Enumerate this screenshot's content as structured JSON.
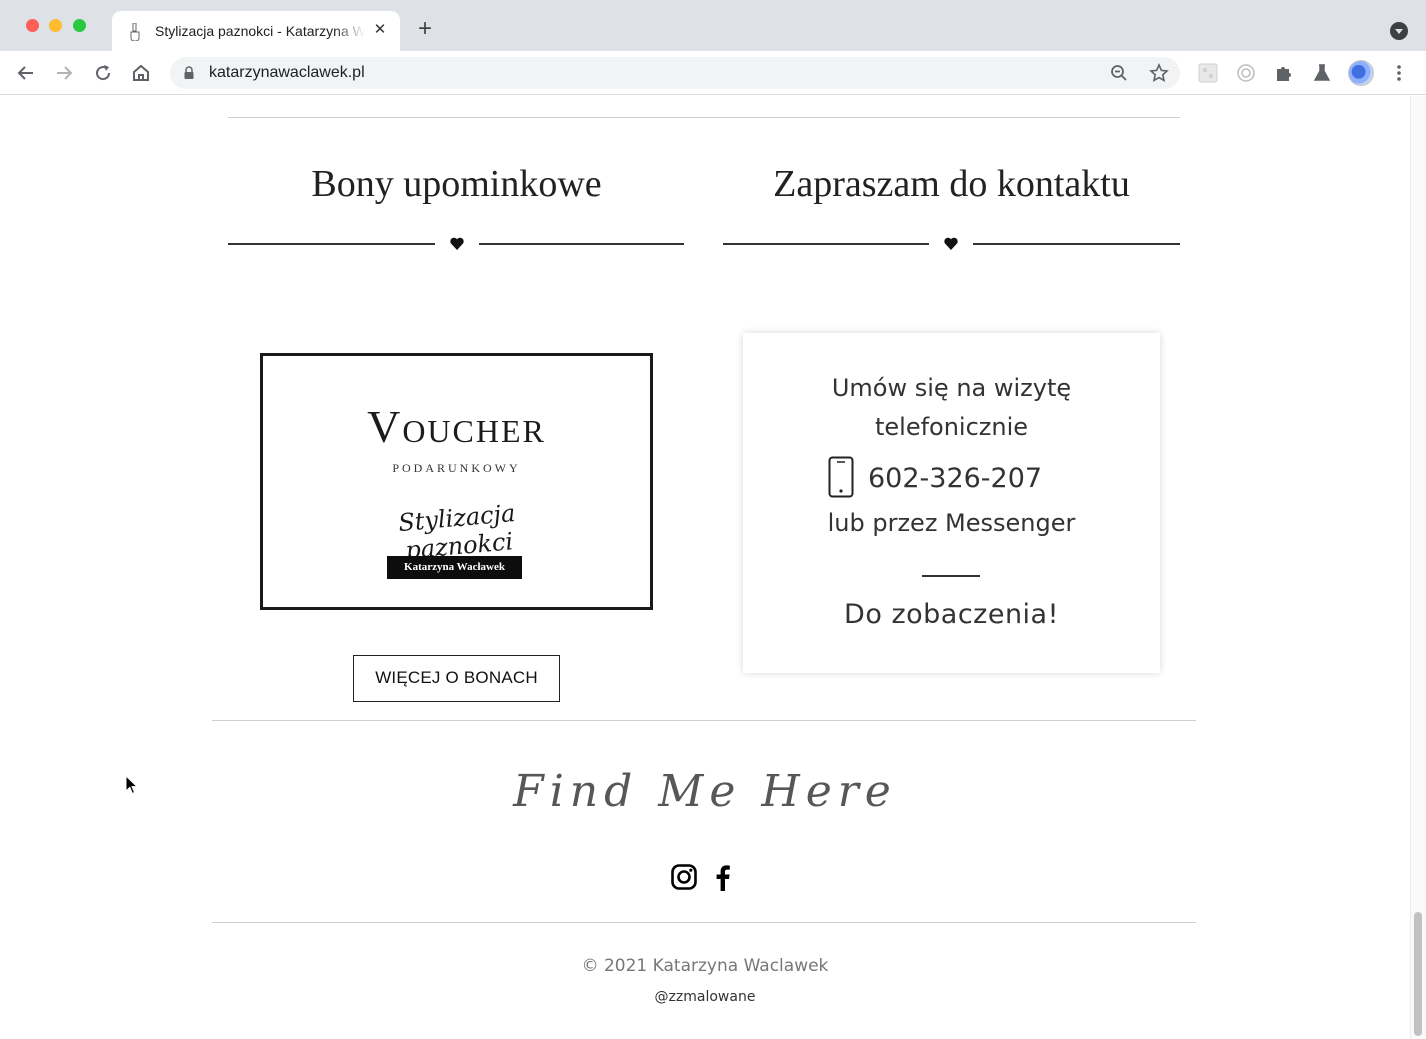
{
  "browser": {
    "tab_title": "Stylizacja paznokci - Katarzyna Waclawek",
    "new_tab_label": "+",
    "close_tab_label": "✕",
    "url": "katarzynawaclawek.pl"
  },
  "gift_section": {
    "title": "Bony upominkowe",
    "voucher": {
      "title": "Voucher",
      "subtitle": "PODARUNKOWY",
      "script": "Stylizacja paznokci",
      "badge": "Katarzyna Wacławek"
    },
    "button_label": "WIĘCEJ O BONACH"
  },
  "contact_section": {
    "title": "Zapraszam do kontaktu",
    "line1": "Umów się na wizytę",
    "line2": "telefonicznie",
    "phone": "602-326-207",
    "line3": "lub przez Messenger",
    "farewell": "Do zobaczenia!"
  },
  "footer": {
    "find_me": "Find Me Here",
    "social": [
      "instagram-icon",
      "facebook-icon"
    ],
    "copyright": "© 2021 Katarzyna Waclawek",
    "handle": "@zzmalowane"
  },
  "colors": {
    "text_dark": "#222222",
    "text_muted": "#777777",
    "chrome_bg": "#dee1e6"
  }
}
